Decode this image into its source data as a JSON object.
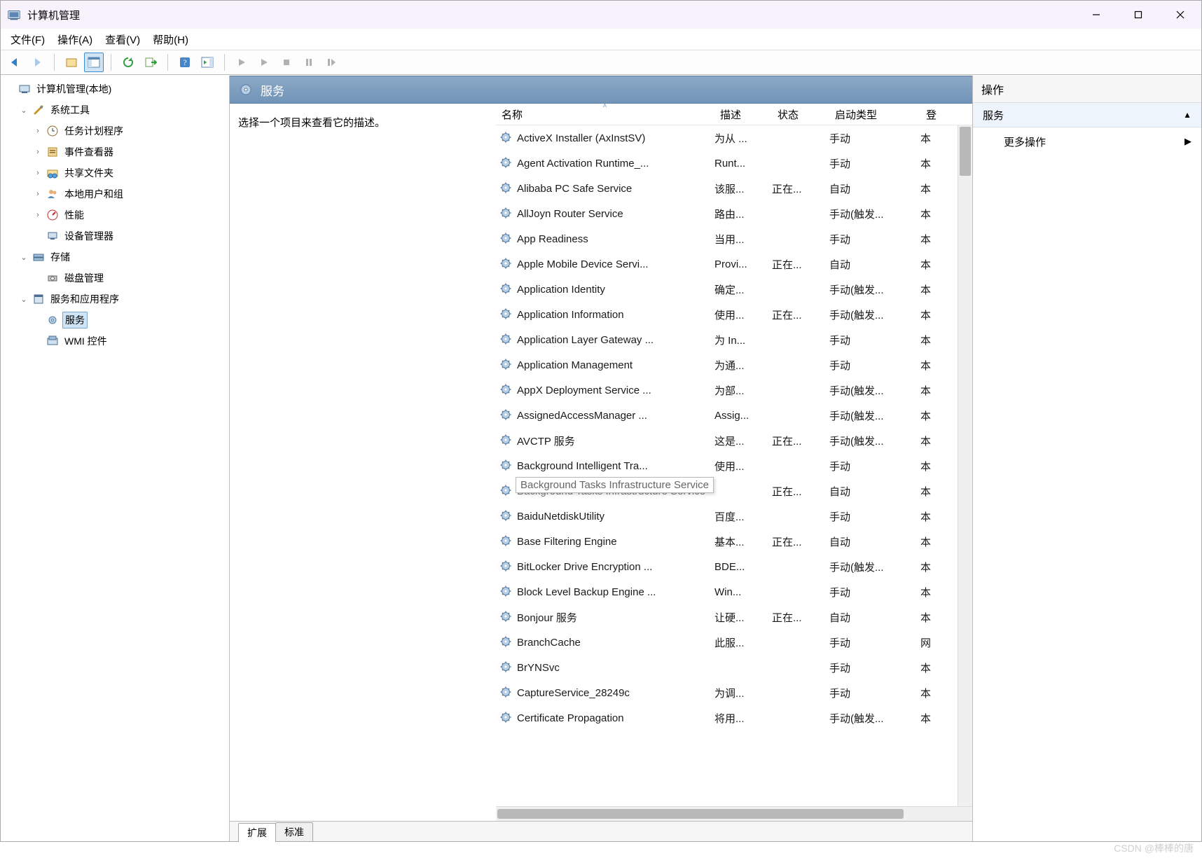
{
  "window": {
    "title": "计算机管理"
  },
  "menubar": [
    "文件(F)",
    "操作(A)",
    "查看(V)",
    "帮助(H)"
  ],
  "tree": {
    "root": "计算机管理(本地)",
    "systools": {
      "label": "系统工具",
      "children": {
        "sched": "任务计划程序",
        "event": "事件查看器",
        "shares": "共享文件夹",
        "users": "本地用户和组",
        "perf": "性能",
        "devmgr": "设备管理器"
      }
    },
    "storage": {
      "label": "存储",
      "children": {
        "diskmgmt": "磁盘管理"
      }
    },
    "svcapps": {
      "label": "服务和应用程序",
      "children": {
        "services": "服务",
        "wmi": "WMI 控件"
      }
    }
  },
  "centerHeader": "服务",
  "descHint": "选择一个项目来查看它的描述。",
  "columns": {
    "name": "名称",
    "desc": "描述",
    "status": "状态",
    "startup": "启动类型",
    "logon": "登"
  },
  "tooltip": {
    "text": "Background Tasks Infrastructure Service",
    "rowIndex": 15
  },
  "services": [
    {
      "name": "ActiveX Installer (AxInstSV)",
      "desc": "为从 ...",
      "status": "",
      "startup": "手动",
      "logon": "本"
    },
    {
      "name": "Agent Activation Runtime_...",
      "desc": "Runt...",
      "status": "",
      "startup": "手动",
      "logon": "本"
    },
    {
      "name": "Alibaba PC Safe Service",
      "desc": "该服...",
      "status": "正在...",
      "startup": "自动",
      "logon": "本"
    },
    {
      "name": "AllJoyn Router Service",
      "desc": "路由...",
      "status": "",
      "startup": "手动(触发...",
      "logon": "本"
    },
    {
      "name": "App Readiness",
      "desc": "当用...",
      "status": "",
      "startup": "手动",
      "logon": "本"
    },
    {
      "name": "Apple Mobile Device Servi...",
      "desc": "Provi...",
      "status": "正在...",
      "startup": "自动",
      "logon": "本"
    },
    {
      "name": "Application Identity",
      "desc": "确定...",
      "status": "",
      "startup": "手动(触发...",
      "logon": "本"
    },
    {
      "name": "Application Information",
      "desc": "使用...",
      "status": "正在...",
      "startup": "手动(触发...",
      "logon": "本"
    },
    {
      "name": "Application Layer Gateway ...",
      "desc": "为 In...",
      "status": "",
      "startup": "手动",
      "logon": "本"
    },
    {
      "name": "Application Management",
      "desc": "为通...",
      "status": "",
      "startup": "手动",
      "logon": "本"
    },
    {
      "name": "AppX Deployment Service ...",
      "desc": "为部...",
      "status": "",
      "startup": "手动(触发...",
      "logon": "本"
    },
    {
      "name": "AssignedAccessManager ...",
      "desc": "Assig...",
      "status": "",
      "startup": "手动(触发...",
      "logon": "本"
    },
    {
      "name": "AVCTP 服务",
      "desc": "这是...",
      "status": "正在...",
      "startup": "手动(触发...",
      "logon": "本"
    },
    {
      "name": "Background Intelligent Tra...",
      "desc": "使用...",
      "status": "",
      "startup": "手动",
      "logon": "本"
    },
    {
      "name": "Background Tasks Infrastructure Service",
      "desc": "",
      "status": "正在...",
      "startup": "自动",
      "logon": "本"
    },
    {
      "name": "BaiduNetdiskUtility",
      "desc": "百度...",
      "status": "",
      "startup": "手动",
      "logon": "本"
    },
    {
      "name": "Base Filtering Engine",
      "desc": "基本...",
      "status": "正在...",
      "startup": "自动",
      "logon": "本"
    },
    {
      "name": "BitLocker Drive Encryption ...",
      "desc": "BDE...",
      "status": "",
      "startup": "手动(触发...",
      "logon": "本"
    },
    {
      "name": "Block Level Backup Engine ...",
      "desc": "Win...",
      "status": "",
      "startup": "手动",
      "logon": "本"
    },
    {
      "name": "Bonjour 服务",
      "desc": "让硬...",
      "status": "正在...",
      "startup": "自动",
      "logon": "本"
    },
    {
      "name": "BranchCache",
      "desc": "此服...",
      "status": "",
      "startup": "手动",
      "logon": "网"
    },
    {
      "name": "BrYNSvc",
      "desc": "",
      "status": "",
      "startup": "手动",
      "logon": "本"
    },
    {
      "name": "CaptureService_28249c",
      "desc": "为调...",
      "status": "",
      "startup": "手动",
      "logon": "本"
    },
    {
      "name": "Certificate Propagation",
      "desc": "将用...",
      "status": "",
      "startup": "手动(触发...",
      "logon": "本"
    }
  ],
  "tabs": {
    "extended": "扩展",
    "standard": "标准"
  },
  "actions": {
    "title": "操作",
    "section": "服务",
    "more": "更多操作"
  },
  "watermark": "CSDN @棒棒的唐"
}
